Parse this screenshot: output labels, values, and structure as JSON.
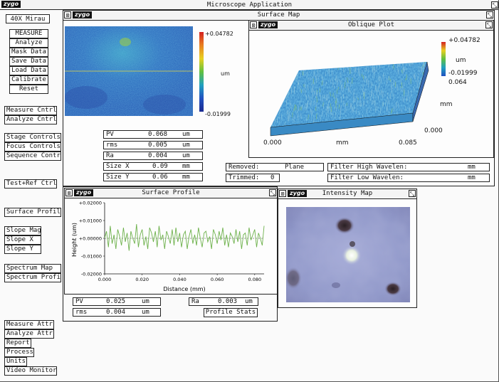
{
  "app": {
    "logo": "zygo",
    "title": "Microscope  Application"
  },
  "objective": "40X  Mirau",
  "menu_top": [
    "MEASURE",
    "Analyze",
    "Mask Data",
    "Save Data",
    "Load Data",
    "Calibrate",
    "Reset"
  ],
  "menu_cntrl": [
    "Measure Cntrl",
    "Analyze Cntrl"
  ],
  "menu_controls": [
    "Stage Controls",
    "Focus Controls",
    "Sequence Control"
  ],
  "menu_testref": "Test+Ref Ctrl",
  "menu_surface": "Surface Profile",
  "menu_slope": [
    "Slope Mag",
    "Slope X",
    "Slope Y"
  ],
  "menu_spectrum": [
    "Spectrum Map",
    "Spectrum Profile"
  ],
  "menu_bottom": [
    "Measure Attr",
    "Analyze Attr",
    "Report",
    "Process",
    "Units",
    "Video Monitor"
  ],
  "surface_map": {
    "logo": "zygo",
    "title": "Surface Map",
    "scale_max": "+0.04782",
    "scale_unit": "um",
    "scale_min": "-0.01999",
    "stats": [
      {
        "label": "PV",
        "value": "0.068",
        "unit": "um"
      },
      {
        "label": "rms",
        "value": "0.005",
        "unit": "um"
      },
      {
        "label": "Ra",
        "value": "0.004",
        "unit": "um"
      },
      {
        "label": "Size X",
        "value": "0.09",
        "unit": "mm"
      },
      {
        "label": "Size Y",
        "value": "0.06",
        "unit": "mm"
      }
    ],
    "removed_label": "Removed:",
    "removed_value": "Plane",
    "trimmed_label": "Trimmed:",
    "trimmed_value": "0",
    "filter_high_label": "Filter High Wavelen:",
    "filter_high_unit": "mm",
    "filter_low_label": "Filter Low  Wavelen:",
    "filter_low_unit": "mm"
  },
  "oblique_plot": {
    "logo": "zygo",
    "title": "Oblique Plot",
    "scale_max": "+0.04782",
    "scale_unit": "um",
    "scale_min": "-0.01999",
    "y_max": "0.064",
    "y_unit": "mm",
    "y_min": "0.000",
    "x_min": "0.000",
    "x_unit": "mm",
    "x_max": "0.085"
  },
  "surface_profile": {
    "logo": "zygo",
    "title": "Surface Profile",
    "ylabel": "Height (um)",
    "xlabel": "Distance (mm)",
    "yticks": [
      "+0.02000",
      "+0.01000",
      "+0.00000",
      "-0.01000",
      "-0.02000"
    ],
    "xticks": [
      "0.000",
      "0.020",
      "0.040",
      "0.060",
      "0.080"
    ],
    "stats": [
      {
        "label": "PV",
        "value": "0.025",
        "unit": "um"
      },
      {
        "label": "rms",
        "value": "0.004",
        "unit": "um"
      }
    ],
    "ra_label": "Ra",
    "ra_value": "0.003",
    "ra_unit": "um",
    "profile_stats_button": "Profile Stats"
  },
  "intensity_map": {
    "logo": "zygo",
    "title": "Intensity Map"
  },
  "chart_data": {
    "type": "line",
    "title": "Surface Profile",
    "xlabel": "Distance (mm)",
    "ylabel": "Height (um)",
    "xlim": [
      0,
      0.085
    ],
    "ylim": [
      -0.02,
      0.02
    ],
    "grid": false,
    "series": [
      {
        "values": [
          0.0,
          0.004,
          -0.005,
          0.007,
          -0.003,
          0.002,
          -0.006,
          0.005,
          0.001,
          -0.004,
          0.006,
          -0.002,
          0.003,
          -0.007,
          0.004,
          0.0,
          -0.003,
          0.008,
          -0.005,
          0.002,
          0.005,
          -0.004,
          0.001,
          -0.006,
          0.006,
          0.003,
          -0.002,
          0.004,
          -0.005,
          0.007,
          -0.001,
          0.002,
          -0.006,
          0.004,
          0.001,
          -0.003,
          0.005,
          -0.004,
          0.006,
          -0.002,
          0.003,
          -0.005,
          0.002,
          0.004,
          -0.006,
          0.001,
          0.005,
          -0.003,
          0.002,
          -0.004,
          0.006,
          0.0,
          -0.005,
          0.003,
          0.004,
          -0.002,
          0.001,
          -0.006,
          0.005,
          0.002,
          -0.003,
          0.004,
          -0.001,
          0.006,
          -0.004,
          0.002,
          -0.005,
          0.003,
          0.001,
          -0.003,
          0.005,
          -0.002,
          0.004,
          -0.006,
          0.002,
          0.003,
          -0.004,
          0.006,
          -0.001,
          0.002,
          0.005,
          -0.005,
          0.003,
          0.0,
          -0.004,
          0.007
        ]
      }
    ]
  },
  "colors": {
    "plot_line": "#6db14b",
    "map_mid": "#2f7fc0"
  }
}
